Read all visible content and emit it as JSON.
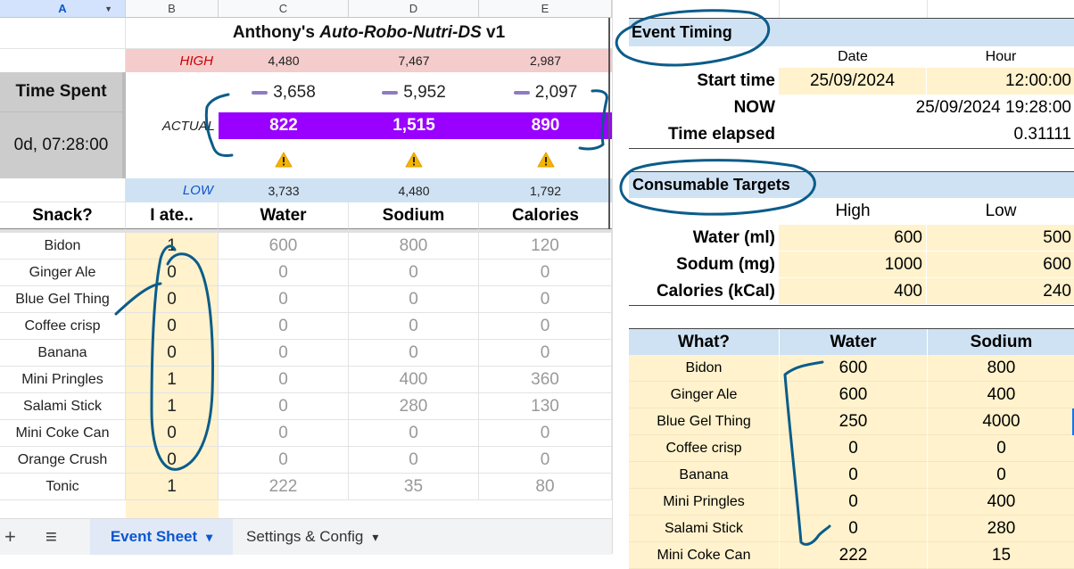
{
  "left": {
    "col_headers": [
      "A",
      "B",
      "C",
      "D",
      "E"
    ],
    "title_plain": "Anthony's ",
    "title_italic": "Auto-Robo-Nutri-DS",
    "title_suffix": " v1",
    "high_label": "HIGH",
    "high_values": [
      "4,480",
      "7,467",
      "2,987"
    ],
    "time_spent_label": "Time Spent",
    "time_spent_value": "0d, 07:28:00",
    "target_values": [
      "3,658",
      "5,952",
      "2,097"
    ],
    "actual_label": "ACTUAL",
    "actual_values": [
      "822",
      "1,515",
      "890"
    ],
    "warn_icon": "warning-icon",
    "low_label": "LOW",
    "low_values": [
      "3,733",
      "4,480",
      "1,792"
    ],
    "headers": [
      "Snack?",
      "I ate..",
      "Water",
      "Sodium",
      "Calories"
    ],
    "rows": [
      {
        "name": "Bidon",
        "ate": "1",
        "water": "600",
        "sodium": "800",
        "cal": "120"
      },
      {
        "name": "Ginger Ale",
        "ate": "0",
        "water": "0",
        "sodium": "0",
        "cal": "0"
      },
      {
        "name": "Blue Gel Thing",
        "ate": "0",
        "water": "0",
        "sodium": "0",
        "cal": "0"
      },
      {
        "name": "Coffee crisp",
        "ate": "0",
        "water": "0",
        "sodium": "0",
        "cal": "0"
      },
      {
        "name": "Banana",
        "ate": "0",
        "water": "0",
        "sodium": "0",
        "cal": "0"
      },
      {
        "name": "Mini Pringles",
        "ate": "1",
        "water": "0",
        "sodium": "400",
        "cal": "360"
      },
      {
        "name": "Salami Stick",
        "ate": "1",
        "water": "0",
        "sodium": "280",
        "cal": "130"
      },
      {
        "name": "Mini Coke Can",
        "ate": "0",
        "water": "0",
        "sodium": "0",
        "cal": "0"
      },
      {
        "name": "Orange Crush",
        "ate": "0",
        "water": "0",
        "sodium": "0",
        "cal": "0"
      },
      {
        "name": "Tonic",
        "ate": "1",
        "water": "222",
        "sodium": "35",
        "cal": "80"
      }
    ]
  },
  "tabs": {
    "add": "+",
    "menu": "≡",
    "event_sheet": "Event Sheet",
    "settings": "Settings & Config",
    "caret": "▾"
  },
  "right": {
    "event_timing_title": "Event Timing",
    "date_hdr": "Date",
    "hour_hdr": "Hour",
    "start_label": "Start time",
    "start_date": "25/09/2024",
    "start_hour": "12:00:00",
    "now_label": "NOW",
    "now_value": "25/09/2024 19:28:00",
    "elapsed_label": "Time elapsed",
    "elapsed_value": "0.31111",
    "targets_title": "Consumable Targets",
    "high_hdr": "High",
    "low_hdr": "Low",
    "targets": [
      {
        "label": "Water (ml)",
        "high": "600",
        "low": "500"
      },
      {
        "label": "Sodum (mg)",
        "high": "1000",
        "low": "600"
      },
      {
        "label": "Calories (kCal)",
        "high": "400",
        "low": "240"
      }
    ],
    "what_hdr": "What?",
    "water_hdr": "Water",
    "sodium_hdr": "Sodium",
    "items": [
      {
        "name": "Bidon",
        "water": "600",
        "sodium": "800"
      },
      {
        "name": "Ginger Ale",
        "water": "600",
        "sodium": "400"
      },
      {
        "name": "Blue Gel Thing",
        "water": "250",
        "sodium": "4000"
      },
      {
        "name": "Coffee crisp",
        "water": "0",
        "sodium": "0"
      },
      {
        "name": "Banana",
        "water": "0",
        "sodium": "0"
      },
      {
        "name": "Mini Pringles",
        "water": "0",
        "sodium": "400"
      },
      {
        "name": "Salami Stick",
        "water": "0",
        "sodium": "280"
      },
      {
        "name": "Mini Coke Can",
        "water": "222",
        "sodium": "15"
      }
    ]
  },
  "colors": {
    "accent": "#0b57d0",
    "actual_bg": "#9900ff",
    "high_bg": "#f4cccc",
    "low_bg": "#cfe2f3",
    "input_bg": "#fff2cc",
    "ink": "#0b5c8a"
  }
}
